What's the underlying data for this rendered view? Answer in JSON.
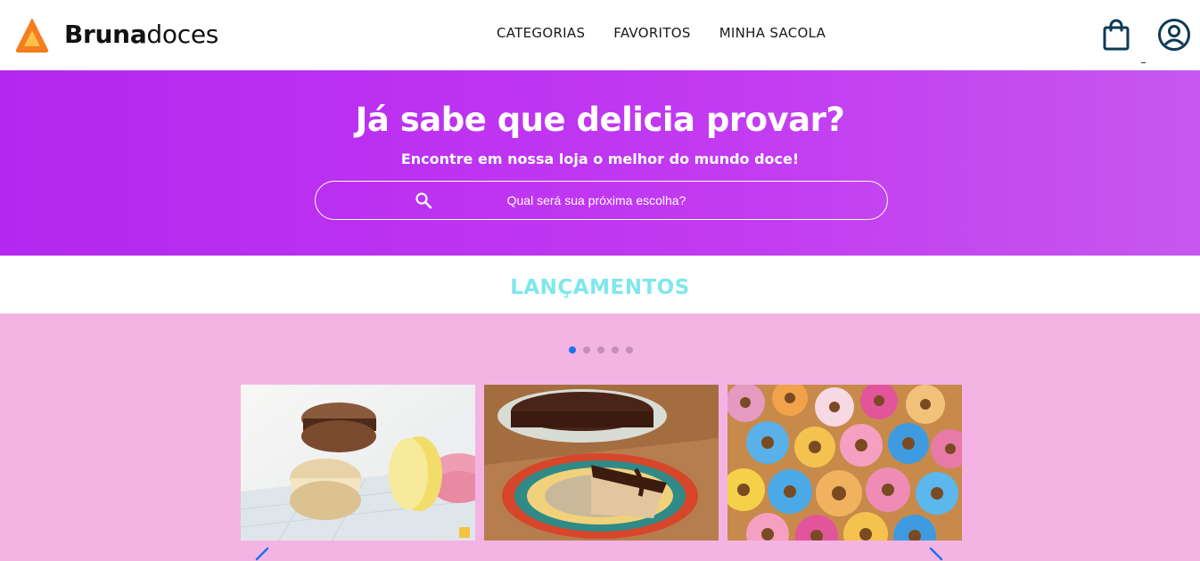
{
  "header": {
    "brand_bold": "Bruna",
    "brand_light": "doces",
    "nav": [
      {
        "label": "CATEGORIAS"
      },
      {
        "label": "FAVORITOS"
      },
      {
        "label": "MINHA SACOLA"
      }
    ],
    "icons": {
      "logo": "orange-triangle-logo",
      "bag": "shopping-bag-icon",
      "user": "user-account-icon"
    }
  },
  "hero": {
    "title": "Já sabe que delicia provar?",
    "subtitle": "Encontre em nossa loja o melhor do mundo doce!",
    "search": {
      "placeholder": "Qual será sua próxima escolha?",
      "icon": "search-icon"
    }
  },
  "launches": {
    "title": "LANÇAMENTOS",
    "dots": 5,
    "active_dot": 1,
    "products": [
      {
        "image": "macarons-photo"
      },
      {
        "image": "chocolate-pie-photo"
      },
      {
        "image": "donuts-photo"
      }
    ],
    "nav_icons": {
      "prev": "chevron-left-icon",
      "next": "chevron-right-icon"
    }
  },
  "colors": {
    "hero_gradient_start": "#b427f0",
    "hero_gradient_end": "#c757ee",
    "section_title": "#7fe7ec",
    "carousel_background": "#f4b4e3",
    "logo_orange": "#f57c1f",
    "icon_navy": "#0e3a55",
    "active_dot": "#1a73e8"
  }
}
